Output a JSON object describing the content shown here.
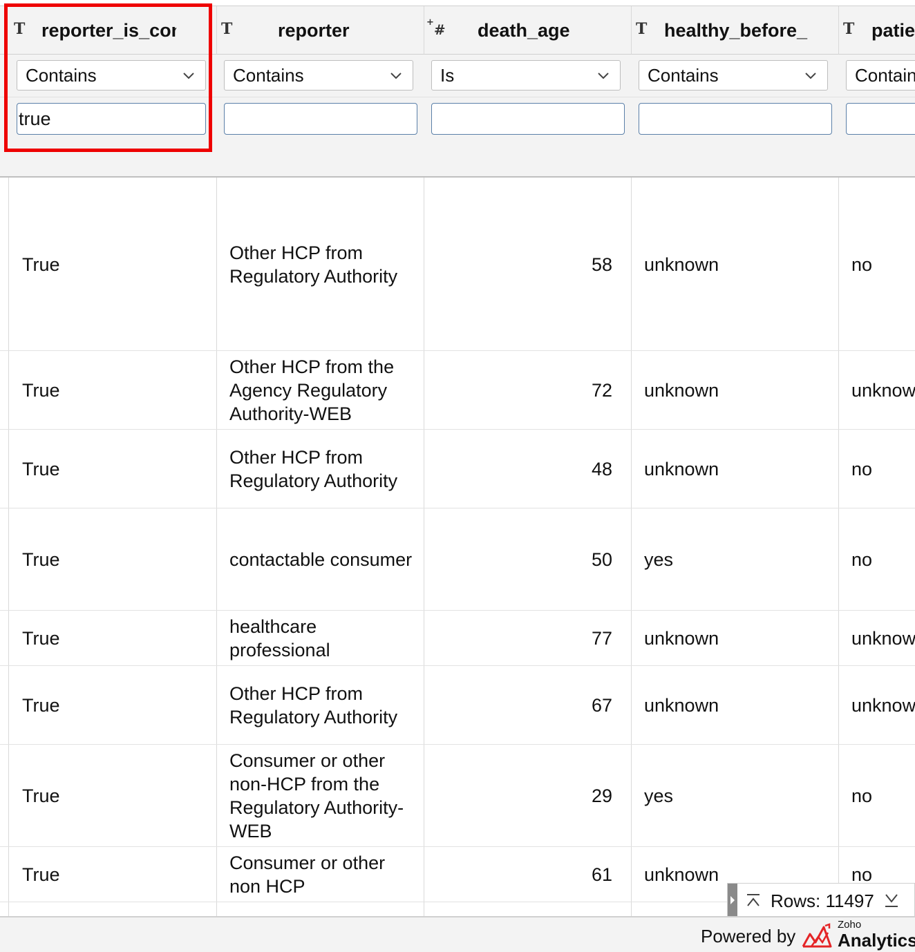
{
  "columns": [
    {
      "type_icon": "T",
      "name": "reporter_is_con",
      "operator": "Contains",
      "filter_value": "true"
    },
    {
      "type_icon": "T",
      "name": "reporter",
      "operator": "Contains",
      "filter_value": ""
    },
    {
      "type_icon": "#",
      "type_prefix": "+",
      "name": "death_age",
      "operator": "Is",
      "filter_value": ""
    },
    {
      "type_icon": "T",
      "name": "healthy_before_",
      "operator": "Contains",
      "filter_value": ""
    },
    {
      "type_icon": "T",
      "name": "patie",
      "operator": "Contain",
      "filter_value": ""
    }
  ],
  "rows": [
    {
      "c1": "True",
      "c2": "Other HCP from Regulatory Authority",
      "c3": "58",
      "c4": "unknown",
      "c5": "no"
    },
    {
      "c1": "True",
      "c2": "Other HCP from the Agency Regulatory Authority-WEB",
      "c3": "72",
      "c4": "unknown",
      "c5": "unknow"
    },
    {
      "c1": "True",
      "c2": "Other HCP from Regulatory Authority",
      "c3": "48",
      "c4": "unknown",
      "c5": "no"
    },
    {
      "c1": "True",
      "c2": "contactable consumer",
      "c3": "50",
      "c4": "yes",
      "c5": "no"
    },
    {
      "c1": "True",
      "c2": "healthcare professional",
      "c3": "77",
      "c4": "unknown",
      "c5": "unknow"
    },
    {
      "c1": "True",
      "c2": "Other HCP from Regulatory Authority",
      "c3": "67",
      "c4": "unknown",
      "c5": "unknow"
    },
    {
      "c1": "True",
      "c2": "Consumer or other non-HCP from the Regulatory Authority-WEB",
      "c3": "29",
      "c4": "yes",
      "c5": "no"
    },
    {
      "c1": "True",
      "c2": "Consumer or other non HCP",
      "c3": "61",
      "c4": "unknown",
      "c5": "no"
    }
  ],
  "rows_counter": "Rows: 11497",
  "footer": {
    "powered_by": "Powered by",
    "brand_small": "Zoho",
    "brand_big": "Analytics"
  },
  "colors": {
    "highlight": "#ee0000",
    "input_border": "#5a7fa8",
    "logo_red": "#e42527"
  }
}
